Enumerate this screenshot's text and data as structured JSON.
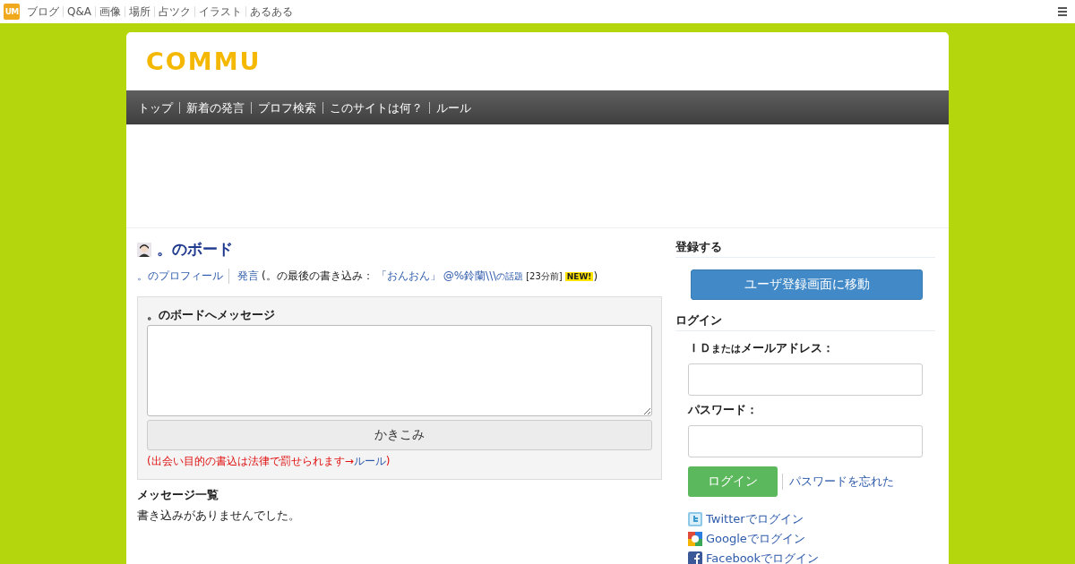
{
  "top_bar": {
    "logo": "UM",
    "links": [
      {
        "label": "ブログ"
      },
      {
        "label": "Q&A"
      },
      {
        "label": "画像"
      },
      {
        "label": "場所"
      },
      {
        "label": "占ツク"
      },
      {
        "label": "イラスト"
      },
      {
        "label": "あるある"
      }
    ]
  },
  "site": {
    "logo": "COMMU"
  },
  "nav": [
    {
      "label": "トップ"
    },
    {
      "label": "新着の発言"
    },
    {
      "label": "プロフ検索"
    },
    {
      "label": "このサイトは何？"
    },
    {
      "label": "ルール"
    }
  ],
  "board": {
    "title": "。のボード",
    "meta": {
      "profile_link": "。のプロフィール",
      "posts_link": "発言",
      "last_post_prefix": "(。の最後の書き込み：",
      "last_post_link": "「おんおん」",
      "topic_name": "@%鈴蘭\\\\\\",
      "topic_suffix": "の話題",
      "time": "[23分前]",
      "badge": "NEW!",
      "suffix": ")"
    },
    "form": {
      "label": "。のボードへメッセージ",
      "submit": "かきこみ",
      "warning_prefix": "(出会い目的の書込は法律で罰せられます→",
      "warning_link": "ルール",
      "warning_suffix": ")"
    },
    "messages_title": "メッセージ一覧",
    "empty_text": "書き込みがありませんでした。"
  },
  "sidebar": {
    "register_title": "登録する",
    "register_button": "ユーザ登録画面に移動",
    "login_title": "ログイン",
    "id_label_prefix": "ＩＤ",
    "id_label_small": "または",
    "id_label_suffix": "メールアドレス：",
    "password_label": "パスワード：",
    "login_button": "ログイン",
    "forgot_link": "パスワードを忘れた",
    "social": [
      {
        "kind": "twitter",
        "label": "Twitterでログイン"
      },
      {
        "kind": "google",
        "label": "Googleでログイン"
      },
      {
        "kind": "facebook",
        "label": "Facebookでログイン"
      }
    ]
  }
}
